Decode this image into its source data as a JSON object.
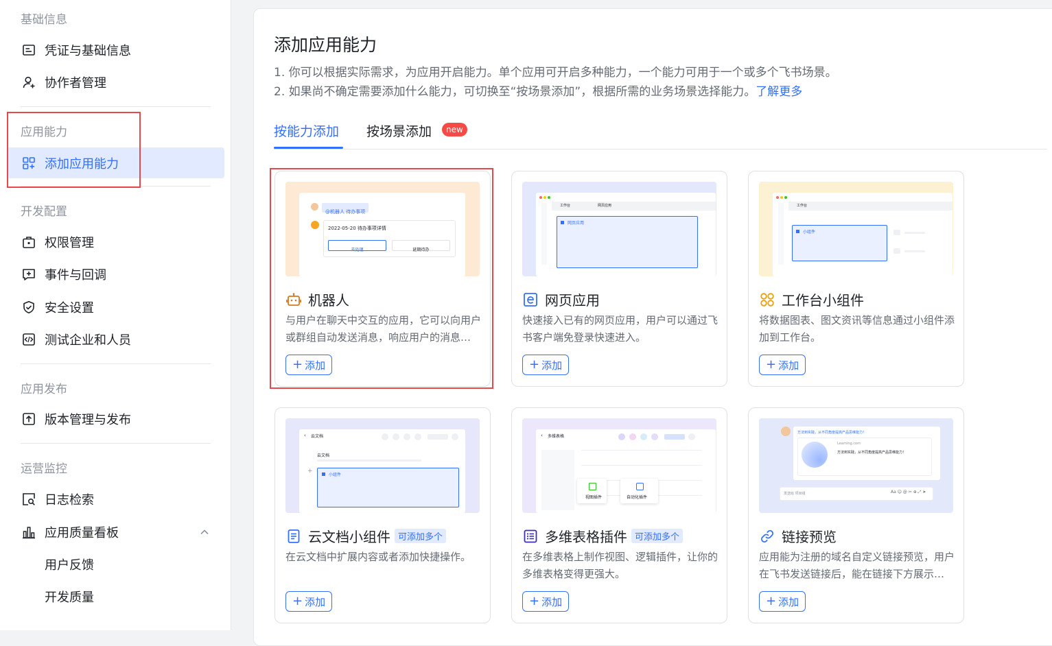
{
  "sidebar": {
    "groups": [
      {
        "title": "基础信息"
      },
      {
        "title": "应用能力"
      },
      {
        "title": "开发配置"
      },
      {
        "title": "应用发布"
      },
      {
        "title": "运营监控"
      }
    ],
    "items": [
      {
        "label": "凭证与基础信息",
        "icon": "credential-icon"
      },
      {
        "label": "协作者管理",
        "icon": "user-add-icon"
      },
      {
        "label": "添加应用能力",
        "icon": "apps-add-icon",
        "active": true
      },
      {
        "label": "权限管理",
        "icon": "lock-briefcase-icon"
      },
      {
        "label": "事件与回调",
        "icon": "event-add-icon"
      },
      {
        "label": "安全设置",
        "icon": "shield-check-icon"
      },
      {
        "label": "测试企业和人员",
        "icon": "code-icon"
      },
      {
        "label": "版本管理与发布",
        "icon": "upload-icon"
      },
      {
        "label": "日志检索",
        "icon": "log-search-icon"
      },
      {
        "label": "应用质量看板",
        "icon": "bar-chart-icon"
      },
      {
        "label": "用户反馈"
      },
      {
        "label": "开发质量"
      }
    ]
  },
  "main": {
    "title": "添加应用能力",
    "desc_line1": "1. 你可以根据实际需求，为应用开启能力。单个应用可开启多种能力，一个能力可用于一个或多个飞书场景。",
    "desc_line2": "2. 如果尚不确定需要添加什么能力，可切换至“按场景添加”，根据所需的业务场景选择能力。",
    "learn_more": "了解更多",
    "tabs": [
      {
        "label": "按能力添加",
        "active": true
      },
      {
        "label": "按场景添加",
        "badge": "new"
      }
    ],
    "add_label": "添加",
    "cards": [
      {
        "title": "机器人",
        "icon": "robot-icon",
        "desc": "与用户在聊天中交互的应用，它可以向用户或群组自动发送消息，响应用户的消息和指令",
        "tag": "",
        "preview_bg": "#fde9d4",
        "preview": {
          "chip": "@机器人  待办事项",
          "row": "2022-05-20 待办事项详情",
          "btn1": "去处理",
          "btn2": "延期待办"
        }
      },
      {
        "title": "网页应用",
        "icon": "web-app-icon",
        "desc": "快速接入已有的网页应用，用户可以通过飞书客户端免登录快速进入。",
        "tag": "",
        "preview_bg": "#e3e8fd",
        "preview": {
          "tab1": "工作台",
          "tab2": "网页应用",
          "panel": "网页应用"
        }
      },
      {
        "title": "工作台小组件",
        "icon": "widget-icon",
        "desc": "将数据图表、图文资讯等信息通过小组件添加到工作台。",
        "tag": "",
        "preview_bg": "#fcf1d3",
        "preview": {
          "tab1": "工作台",
          "panel": "小组件"
        }
      },
      {
        "title": "云文档小组件",
        "icon": "doc-icon",
        "desc": "在云文档中扩展内容或者添加快捷操作。",
        "tag": "可添加多个",
        "preview_bg": "#e6e7fb",
        "preview": {
          "header": "云文档",
          "line": "云文档",
          "panel": "小组件"
        }
      },
      {
        "title": "多维表格插件",
        "icon": "table-list-icon",
        "desc": "在多维表格上制作视图、逻辑插件，让你的多维表格变得更强大。",
        "tag": "可添加多个",
        "preview_bg": "#ece7fb",
        "preview": {
          "header": "多维表格",
          "plugin1": "视图插件",
          "plugin2": "自动化插件"
        }
      },
      {
        "title": "链接预览",
        "icon": "link-icon",
        "desc": "应用能为注册的域名自定义链接预览，用户在飞书发送链接后，能在链接下方展示预览信息",
        "tag": "",
        "preview_bg": "#e3e8fb",
        "preview": {
          "msg": "方法到实践，从不同角度提高产品思维能力！",
          "site": "Learning.com",
          "card": "方法到实践，从不同角度提高产品思维能力！",
          "input": "发送给 项目组"
        }
      }
    ]
  }
}
